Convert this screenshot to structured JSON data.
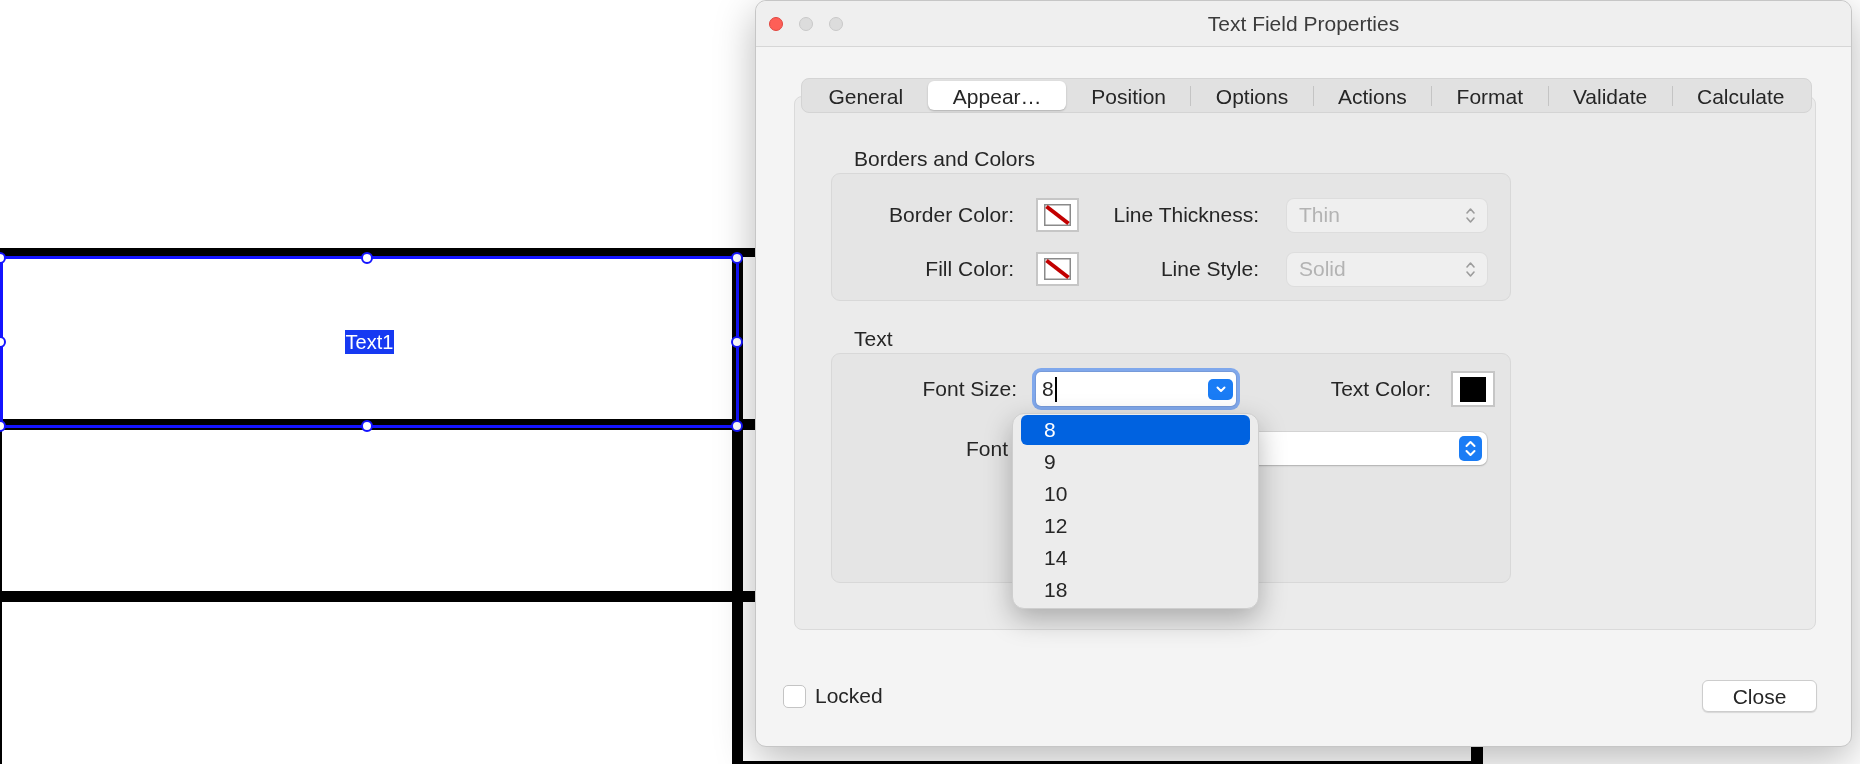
{
  "window": {
    "title": "Text Field Properties"
  },
  "document": {
    "field": {
      "label": "Text1",
      "selected": true
    }
  },
  "tabs": [
    {
      "label": "General",
      "selected": false
    },
    {
      "label": "Appear…",
      "selected": true
    },
    {
      "label": "Position",
      "selected": false
    },
    {
      "label": "Options",
      "selected": false
    },
    {
      "label": "Actions",
      "selected": false
    },
    {
      "label": "Format",
      "selected": false
    },
    {
      "label": "Validate",
      "selected": false
    },
    {
      "label": "Calculate",
      "selected": false
    }
  ],
  "borders_and_colors": {
    "title": "Borders and Colors",
    "rows": [
      {
        "color_label": "Border Color:",
        "color": {
          "none": true
        },
        "select_label": "Line Thickness:",
        "select": {
          "value": "Thin",
          "disabled": true
        }
      },
      {
        "color_label": "Fill Color:",
        "color": {
          "none": true
        },
        "select_label": "Line Style:",
        "select": {
          "value": "Solid",
          "disabled": true
        }
      }
    ]
  },
  "text": {
    "title": "Text",
    "font_size": {
      "label": "Font Size:",
      "value": "8",
      "focused": true,
      "expanded": true,
      "options": [
        {
          "label": "8",
          "selected": true
        },
        {
          "label": "9",
          "selected": false
        },
        {
          "label": "10",
          "selected": false
        },
        {
          "label": "12",
          "selected": false
        },
        {
          "label": "14",
          "selected": false
        },
        {
          "label": "18",
          "selected": false
        }
      ]
    },
    "text_color": {
      "label": "Text Color:",
      "color": {
        "none": false,
        "color": "#000000"
      }
    },
    "font": {
      "label": "Font",
      "select": {
        "disabled": false
      }
    }
  },
  "locked": {
    "label": "Locked",
    "checked": false
  },
  "close_button": {
    "label": "Close"
  }
}
